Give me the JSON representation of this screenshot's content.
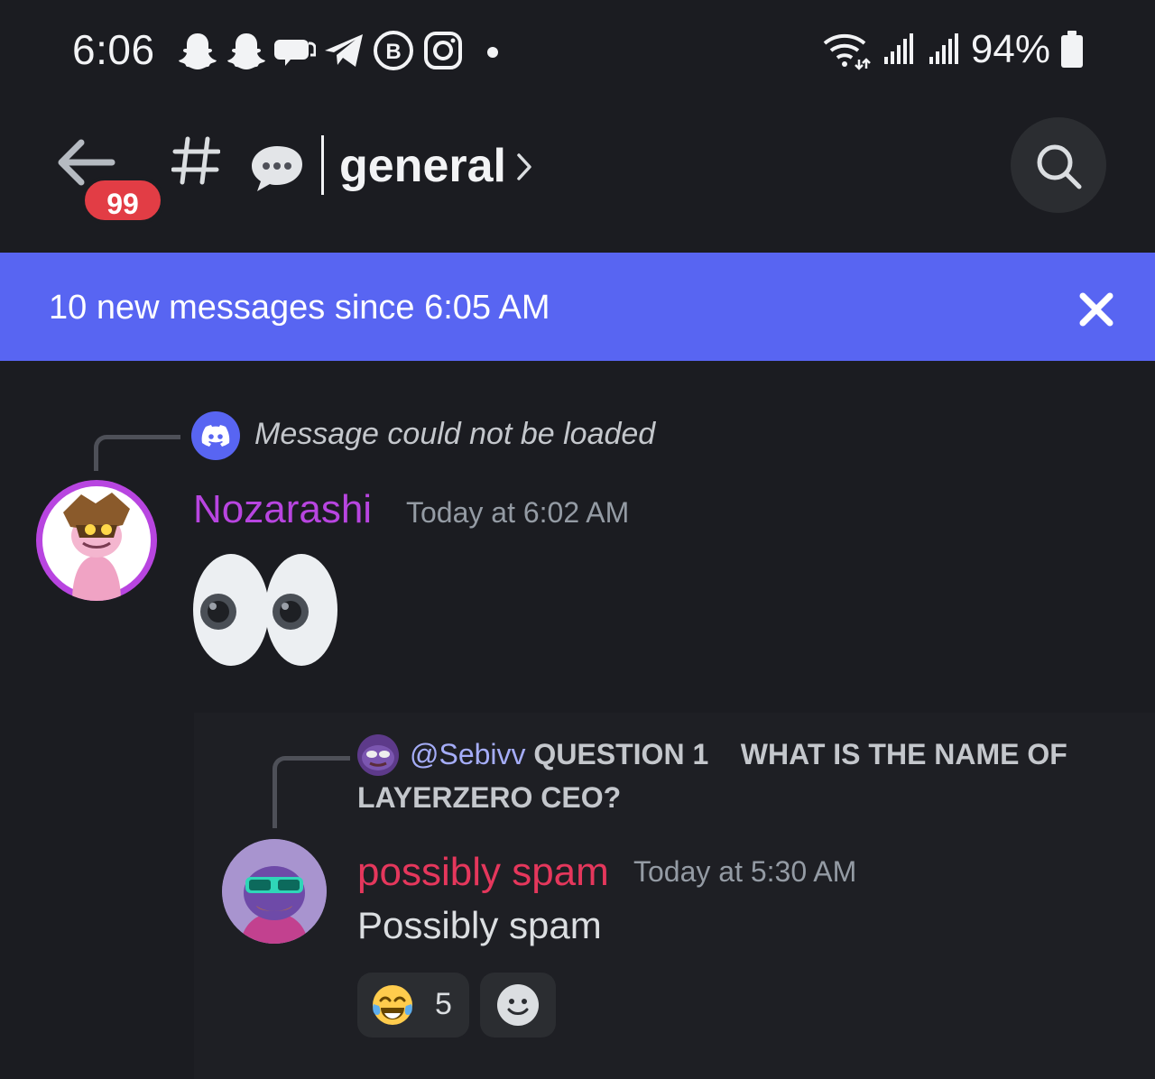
{
  "status_bar": {
    "time": "6:06",
    "battery_percent": "94%",
    "icons": [
      "snapchat-icon",
      "snapchat-icon",
      "messages-icon",
      "telegram-icon",
      "business-icon",
      "instagram-icon",
      "dot-icon",
      "wifi-icon",
      "signal-icon",
      "signal-icon",
      "battery-icon"
    ]
  },
  "header": {
    "unread_badge": "99",
    "channel_emoji": "speech-bubble",
    "channel_name": "general"
  },
  "new_messages_bar": {
    "text": "10 new messages since 6:05 AM"
  },
  "messages": [
    {
      "reply_text": "Message could not be loaded",
      "author": "Nozarashi",
      "author_color": "#b845e0",
      "timestamp": "Today at 6:02 AM",
      "content_emoji": "eyes"
    },
    {
      "reply_mention": "@Sebivv",
      "reply_text_line1": "QUESTION 1    WHAT IS THE NAME OF",
      "reply_text_line2": "LAYERZERO CEO?",
      "author": "possibly spam",
      "author_color": "#e5375c",
      "timestamp": "Today at 5:30 AM",
      "content": "Possibly spam",
      "reactions": [
        {
          "emoji": "joy",
          "count": "5"
        },
        {
          "emoji": "add-reaction",
          "count": ""
        }
      ]
    }
  ],
  "colors": {
    "background": "#1b1c21",
    "accent": "#5865f2",
    "badge": "#e23d45"
  }
}
